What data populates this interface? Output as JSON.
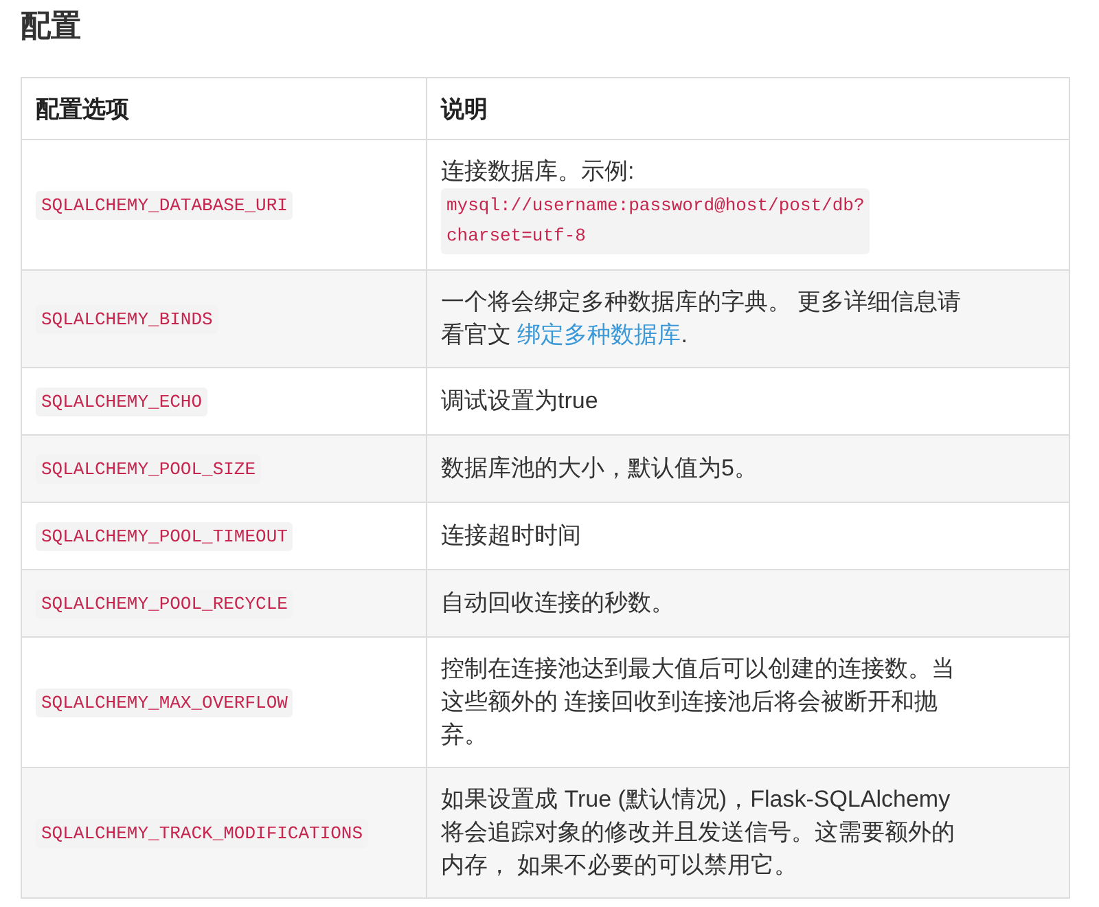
{
  "heading": "配置",
  "table": {
    "columns": [
      "配置选项",
      "说明"
    ],
    "rows": [
      {
        "option": "SQLALCHEMY_DATABASE_URI",
        "description": [
          {
            "kind": "text",
            "text": "连接数据库。示例:"
          },
          {
            "kind": "code",
            "text": "mysql://username:password@host/post/db?charset=utf-8"
          }
        ]
      },
      {
        "option": "SQLALCHEMY_BINDS",
        "description": [
          {
            "kind": "text",
            "text": "一个将会绑定多种数据库的字典。 更多详细信息请看官文 "
          },
          {
            "kind": "link",
            "text": "绑定多种数据库"
          },
          {
            "kind": "text",
            "text": "."
          }
        ]
      },
      {
        "option": "SQLALCHEMY_ECHO",
        "description": [
          {
            "kind": "text",
            "text": "调试设置为true"
          }
        ]
      },
      {
        "option": "SQLALCHEMY_POOL_SIZE",
        "description": [
          {
            "kind": "text",
            "text": "数据库池的大小，默认值为5。"
          }
        ]
      },
      {
        "option": "SQLALCHEMY_POOL_TIMEOUT",
        "description": [
          {
            "kind": "text",
            "text": "连接超时时间"
          }
        ]
      },
      {
        "option": "SQLALCHEMY_POOL_RECYCLE",
        "description": [
          {
            "kind": "text",
            "text": "自动回收连接的秒数。"
          }
        ]
      },
      {
        "option": "SQLALCHEMY_MAX_OVERFLOW",
        "description": [
          {
            "kind": "text",
            "text": "控制在连接池达到最大值后可以创建的连接数。当这些额外的 连接回收到连接池后将会被断开和抛弃。"
          }
        ]
      },
      {
        "option": "SQLALCHEMY_TRACK_MODIFICATIONS",
        "description": [
          {
            "kind": "text",
            "text": "如果设置成 True (默认情况)，Flask-SQLAlchemy 将会追踪对象的修改并且发送信号。这需要额外的内存， 如果不必要的可以禁用它。"
          }
        ]
      }
    ]
  }
}
